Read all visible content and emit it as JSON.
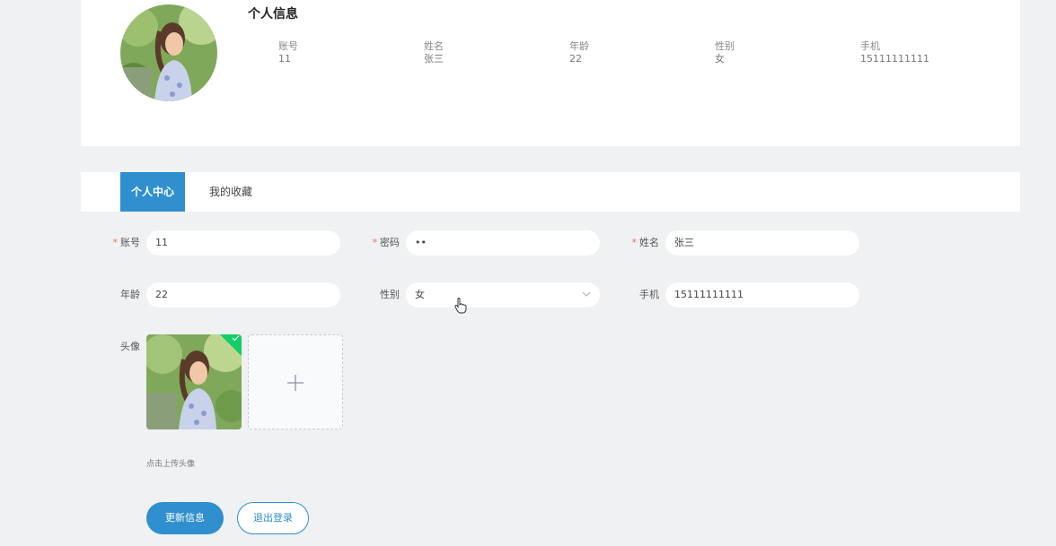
{
  "profile": {
    "title": "个人信息",
    "fields": [
      {
        "label": "账号",
        "value": "11"
      },
      {
        "label": "姓名",
        "value": "张三"
      },
      {
        "label": "年龄",
        "value": "22"
      },
      {
        "label": "性别",
        "value": "女"
      },
      {
        "label": "手机",
        "value": "15111111111"
      }
    ]
  },
  "tabs": [
    {
      "label": "个人中心",
      "active": true
    },
    {
      "label": "我的收藏",
      "active": false
    }
  ],
  "form": {
    "required_mark": "*",
    "account": {
      "label": "账号",
      "value": "11"
    },
    "password": {
      "label": "密码",
      "value": "••"
    },
    "name": {
      "label": "姓名",
      "value": "张三"
    },
    "age": {
      "label": "年龄",
      "value": "22"
    },
    "gender": {
      "label": "性别",
      "value": "女"
    },
    "phone": {
      "label": "手机",
      "value": "15111111111"
    },
    "avatar_label": "头像",
    "upload_tip": "点击上传头像",
    "update_button": "更新信息",
    "logout_button": "退出登录"
  },
  "colors": {
    "accent": "#2f8fcf",
    "success": "#13ce66",
    "required": "#f56c6c"
  },
  "icons": {
    "select": "chevron-down-icon",
    "upload": "plus-icon",
    "uploaded": "check-icon",
    "cursor": "hand-pointer-icon"
  }
}
